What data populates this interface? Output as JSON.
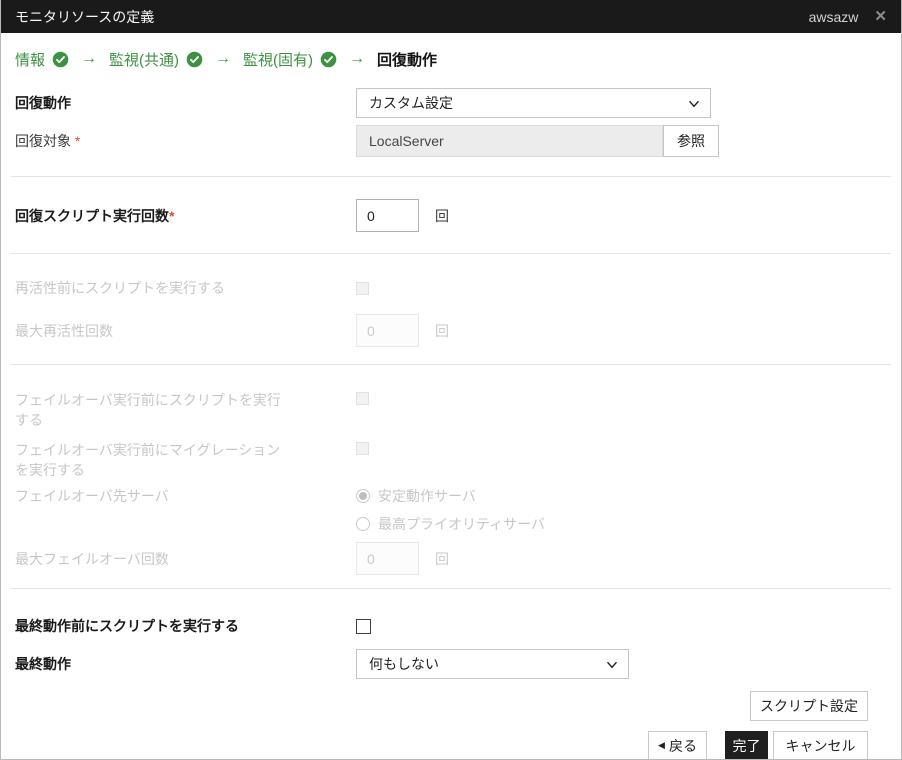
{
  "title_bar": {
    "title": "モニタリソースの定義",
    "resource_name": "awsazw",
    "close_icon": "✕"
  },
  "breadcrumb": {
    "arrow": "→",
    "steps": [
      {
        "label": "情報",
        "completed": true
      },
      {
        "label": "監視(共通)",
        "completed": true
      },
      {
        "label": "監視(固有)",
        "completed": true
      },
      {
        "label": "回復動作",
        "completed": false,
        "current": true
      }
    ]
  },
  "colors": {
    "accent_green": "#3e9142",
    "required_red": "#dd4b39",
    "titlebar_bg": "#1a1a1a",
    "finish_button_bg": "#1f1f1f"
  },
  "form": {
    "recovery_action": {
      "label": "回復動作",
      "value": "カスタム設定"
    },
    "recovery_target": {
      "label": "回復対象",
      "required_mark": "*",
      "value": "LocalServer",
      "browse_label": "参照"
    },
    "recovery_script_count": {
      "label": "回復スクリプト実行回数",
      "required_mark": "*",
      "value": "0",
      "unit": "回"
    },
    "exec_script_before_reactivation": {
      "label": "再活性前にスクリプトを実行する",
      "checked": false,
      "disabled": true
    },
    "max_reactivation": {
      "label": "最大再活性回数",
      "value": "0",
      "unit": "回",
      "disabled": true
    },
    "exec_script_before_failover": {
      "label": "フェイルオーバ実行前にスクリプトを実行する",
      "checked": false,
      "disabled": true
    },
    "exec_migration_before_failover": {
      "label": "フェイルオーバ実行前にマイグレーションを実行する",
      "checked": false,
      "disabled": true
    },
    "failover_target_server": {
      "label": "フェイルオーバ先サーバ",
      "disabled": true,
      "options": [
        {
          "label": "安定動作サーバ",
          "selected": true
        },
        {
          "label": "最高プライオリティサーバ",
          "selected": false
        }
      ]
    },
    "max_failover": {
      "label": "最大フェイルオーバ回数",
      "value": "0",
      "unit": "回",
      "disabled": true
    },
    "exec_script_before_final_action": {
      "label": "最終動作前にスクリプトを実行する",
      "checked": false
    },
    "final_action": {
      "label": "最終動作",
      "value": "何もしない"
    }
  },
  "buttons": {
    "script_settings": "スクリプト設定",
    "back_icon": "◀",
    "back": "戻る",
    "finish": "完了",
    "cancel": "キャンセル"
  }
}
